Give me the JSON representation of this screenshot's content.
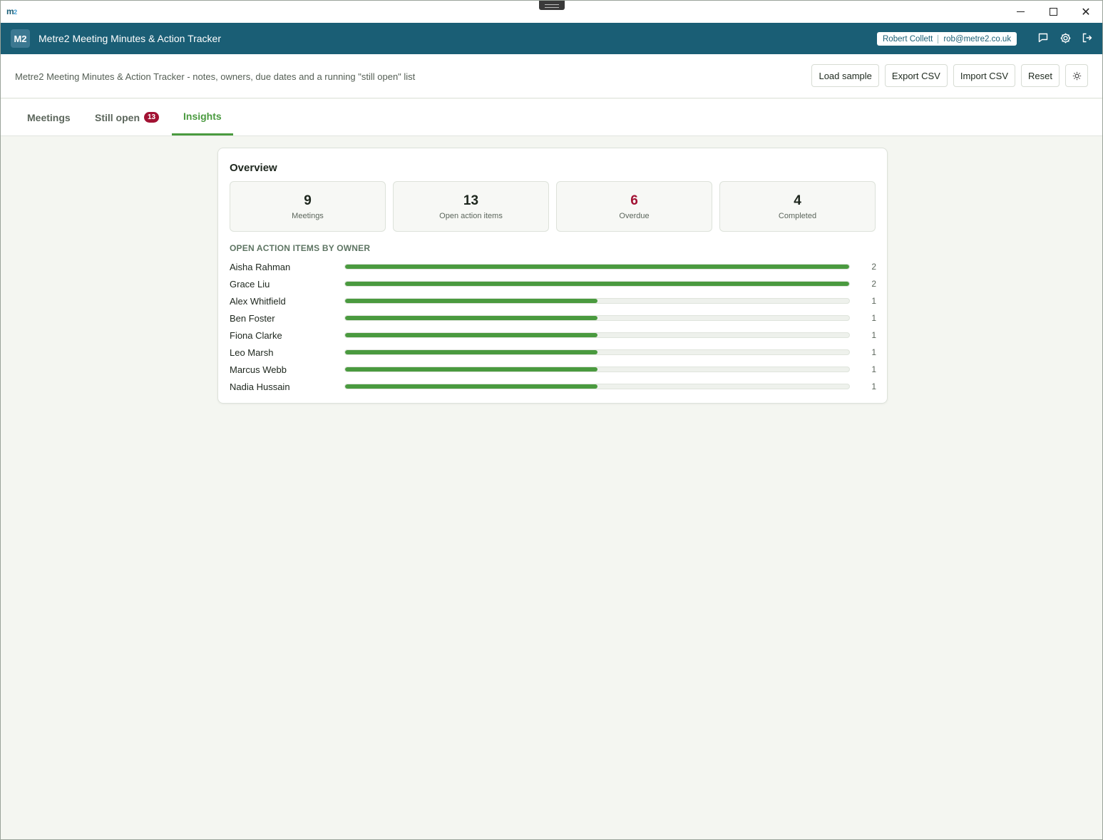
{
  "os": {
    "logo_main": "m",
    "logo_sup": "2",
    "controls": {
      "minimize": "minimize-icon",
      "maximize": "maximize-icon",
      "close": "✕"
    }
  },
  "header": {
    "logo": "M2",
    "title": "Metre2 Meeting Minutes & Action Tracker",
    "user_name": "Robert Collett",
    "user_email": "rob@metre2.co.uk",
    "icons": [
      "chat-icon",
      "settings-icon",
      "logout-icon"
    ]
  },
  "toolbar": {
    "subtitle": "Metre2 Meeting Minutes & Action Tracker - notes, owners, due dates and a running \"still open\" list",
    "load_sample": "Load sample",
    "export_csv": "Export CSV",
    "import_csv": "Import CSV",
    "reset": "Reset",
    "theme_icon": "sun-icon"
  },
  "tabs": {
    "meetings": "Meetings",
    "still_open": "Still open",
    "still_open_count": "13",
    "insights": "Insights",
    "active": "insights"
  },
  "overview": {
    "title": "Overview",
    "stats": [
      {
        "value": "9",
        "label": "Meetings"
      },
      {
        "value": "13",
        "label": "Open action items"
      },
      {
        "value": "6",
        "label": "Overdue"
      },
      {
        "value": "4",
        "label": "Completed"
      }
    ],
    "owners_title": "OPEN ACTION ITEMS BY OWNER",
    "owners_max": 2,
    "owners": [
      {
        "name": "Aisha Rahman",
        "count": 2
      },
      {
        "name": "Grace Liu",
        "count": 2
      },
      {
        "name": "Alex Whitfield",
        "count": 1
      },
      {
        "name": "Ben Foster",
        "count": 1
      },
      {
        "name": "Fiona Clarke",
        "count": 1
      },
      {
        "name": "Leo Marsh",
        "count": 1
      },
      {
        "name": "Marcus Webb",
        "count": 1
      },
      {
        "name": "Nadia Hussain",
        "count": 1
      }
    ]
  },
  "colors": {
    "header_bg": "#1a5e75",
    "accent_green": "#4a9a3f",
    "alert_red": "#a21233"
  }
}
